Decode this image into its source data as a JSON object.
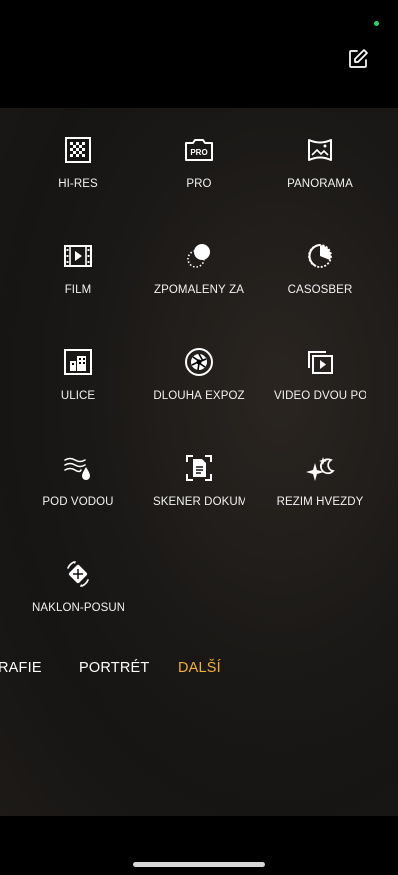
{
  "colors": {
    "accent": "#f0b032",
    "status_dot": "#2fd35c",
    "panel": "#1b1917"
  },
  "header": {
    "edit_icon": "edit-icon"
  },
  "modes": [
    {
      "label": "HI-RES",
      "icon": "hi-res-icon"
    },
    {
      "label": "PRO",
      "icon": "pro-icon"
    },
    {
      "label": "PANORÁMA",
      "icon": "panorama-icon"
    },
    {
      "label": "FILM",
      "icon": "film-icon"
    },
    {
      "label": "ZPOMALENÝ ZÁ",
      "icon": "slow-motion-icon"
    },
    {
      "label": "ČASOSBĚR",
      "icon": "timelapse-icon"
    },
    {
      "label": "ULICE",
      "icon": "street-icon"
    },
    {
      "label": "DLOUHÁ EXPOZ",
      "icon": "long-exposure-icon"
    },
    {
      "label": "VIDEO DVOU PO",
      "icon": "dual-view-video-icon"
    },
    {
      "label": "POD VODOU",
      "icon": "underwater-icon"
    },
    {
      "label": "SKENER DOKUM",
      "icon": "document-scanner-icon"
    },
    {
      "label": "REŽIM HVĚZDY",
      "icon": "star-mode-icon"
    },
    {
      "label": "NÁKLON-POSUN",
      "icon": "tilt-shift-icon"
    }
  ],
  "tabs": [
    {
      "label": "RAFIE",
      "active": false
    },
    {
      "label": "PORTRÉT",
      "active": false
    },
    {
      "label": "DALŠÍ",
      "active": true
    }
  ]
}
